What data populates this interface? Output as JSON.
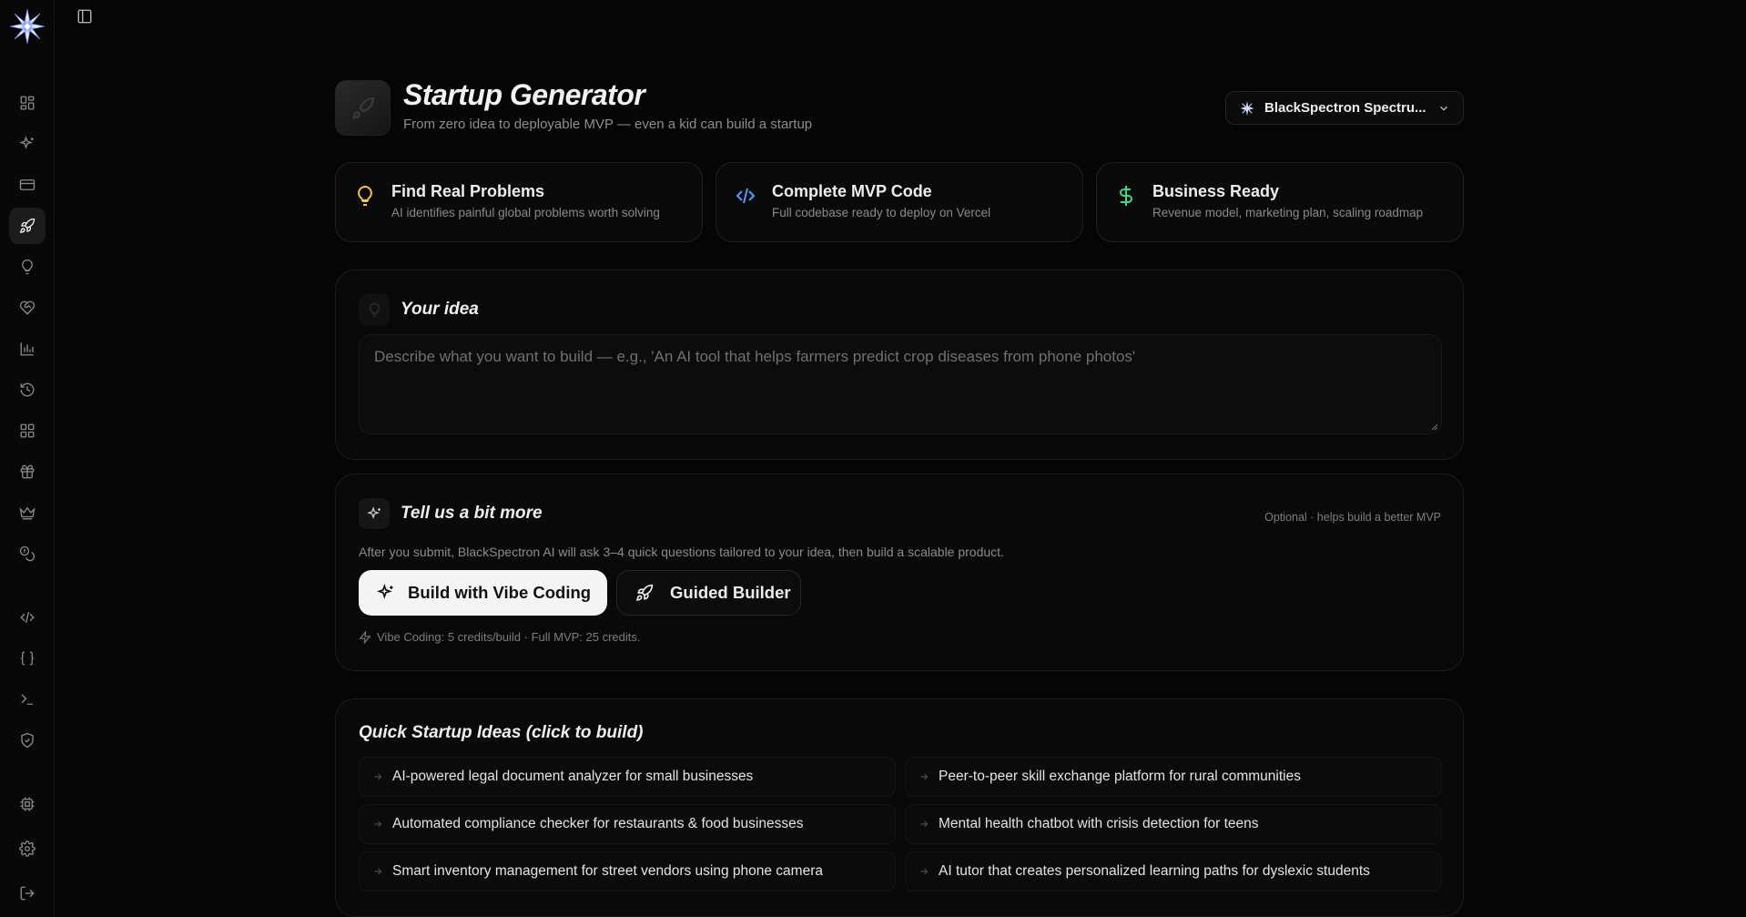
{
  "header": {
    "title": "Startup Generator",
    "subtitle": "From zero idea to deployable MVP — even a kid can build a startup",
    "model_selector": "BlackSpectron Spectru..."
  },
  "features": [
    {
      "title": "Find Real Problems",
      "desc": "AI identifies painful global problems worth solving",
      "icon": "lightbulb-icon",
      "color": "#f5c542"
    },
    {
      "title": "Complete MVP Code",
      "desc": "Full codebase ready to deploy on Vercel",
      "icon": "code-icon",
      "color": "#4a9eff"
    },
    {
      "title": "Business Ready",
      "desc": "Revenue model, marketing plan, scaling roadmap",
      "icon": "dollar-icon",
      "color": "#3ddc84"
    }
  ],
  "idea": {
    "title": "Your idea",
    "placeholder": "Describe what you want to build — e.g., 'An AI tool that helps farmers predict crop diseases from phone photos'"
  },
  "more": {
    "title": "Tell us a bit more",
    "optional": "Optional · helps build a better MVP",
    "desc": "After you submit, BlackSpectron AI will ask 3–4 quick questions tailored to your idea, then build a scalable product.",
    "vibe_button": "Build with Vibe Coding",
    "guided_button": "Guided Builder",
    "credits": "Vibe Coding: 5 credits/build · Full MVP: 25 credits."
  },
  "quick_ideas": {
    "title": "Quick Startup Ideas (click to build)",
    "items": [
      "AI-powered legal document analyzer for small businesses",
      "Peer-to-peer skill exchange platform for rural communities",
      "Automated compliance checker for restaurants & food businesses",
      "Mental health chatbot with crisis detection for teens",
      "Smart inventory management for street vendors using phone camera",
      "AI tutor that creates personalized learning paths for dyslexic students"
    ]
  },
  "sidebar": {
    "items": [
      "dashboard-icon",
      "sparkles-icon",
      "card-icon",
      "rocket-icon",
      "lightbulb-icon",
      "heart-handshake-icon",
      "bar-chart-icon",
      "history-icon",
      "apps-grid-icon",
      "gift-icon",
      "crown-icon",
      "coins-icon",
      "code-icon",
      "braces-icon",
      "terminal-icon",
      "shield-check-icon",
      "cpu-icon",
      "settings-icon",
      "logout-icon"
    ],
    "active": "rocket-icon"
  }
}
